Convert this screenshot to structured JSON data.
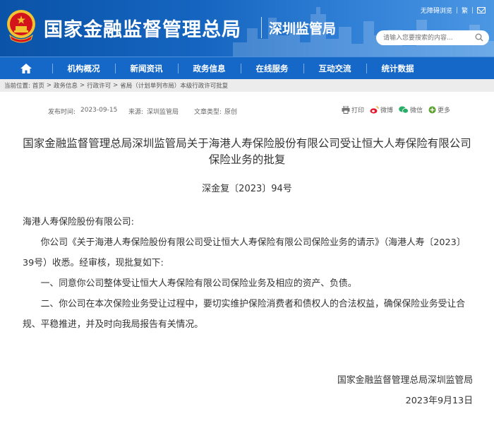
{
  "header": {
    "site_name": "国家金融监督管理总局",
    "branch_name": "深圳监管局",
    "top_links": {
      "accessible": "无障碍浏览",
      "traditional": "繁"
    },
    "search_placeholder": "请输入您要搜索的内容..."
  },
  "nav": {
    "items": [
      {
        "label": "机构概况"
      },
      {
        "label": "新闻资讯"
      },
      {
        "label": "政务信息"
      },
      {
        "label": "在线服务"
      },
      {
        "label": "互动交流"
      },
      {
        "label": "统计数据"
      }
    ]
  },
  "breadcrumb": {
    "label": "当前位置:",
    "items": [
      "首页",
      "政务信息",
      "行政许可",
      "省局（计划单列市局）本级行政许可批复"
    ]
  },
  "meta": {
    "publish_label": "发布时间:",
    "publish_date": "2023-09-15",
    "source_label": "来源:",
    "source": "深圳监管局",
    "type_label": "文章类型:",
    "type": "原创"
  },
  "share": {
    "print": "打印",
    "weibo": "微博",
    "wechat": "微信",
    "more": "更多"
  },
  "article": {
    "title_line1": "国家金融监督管理总局深圳监管局关于海港人寿保险股份有限公司受让恒大人寿保险有限公司",
    "title_line2": "保险业务的批复",
    "doc_number": "深金复〔2023〕94号",
    "salutation": "海港人寿保险股份有限公司:",
    "para1": "你公司《关于海港人寿保险股份有限公司受让恒大人寿保险有限公司保险业务的请示》（海港人寿〔2023〕39号）收悉。经审核，现批复如下:",
    "para2": "一、同意你公司整体受让恒大人寿保险有限公司保险业务及相应的资产、负债。",
    "para3": "二、你公司在本次保险业务受让过程中，要切实维护保险消费者和债权人的合法权益，确保保险业务受让合规、平稳推进，并及时向我局报告有关情况。",
    "signature": "国家金融监督管理总局深圳监管局",
    "date": "2023年9月13日"
  },
  "colors": {
    "header_blue": "#1565c0",
    "nav_blue": "#1668c8",
    "emblem_red": "#d4141c",
    "emblem_gold": "#f2c230"
  }
}
